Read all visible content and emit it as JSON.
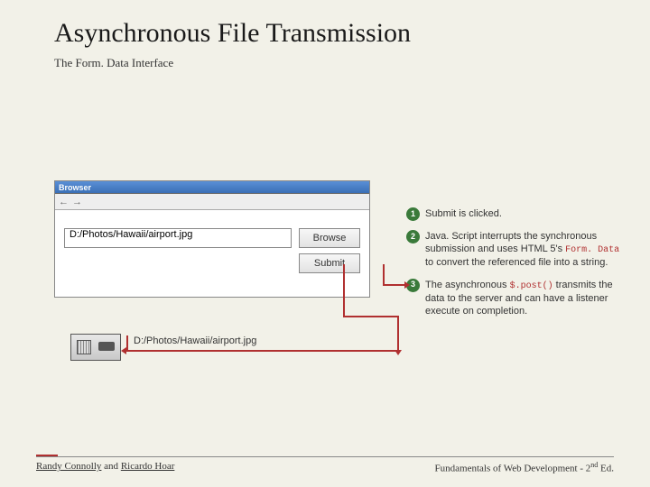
{
  "title": "Asynchronous File Transmission",
  "subtitle": "The Form. Data Interface",
  "browser": {
    "title": "Browser",
    "nav_back": "←",
    "nav_fwd": "→",
    "file_value": "D:/Photos/Hawaii/airport.jpg",
    "browse_label": "Browse",
    "submit_label": "Submit"
  },
  "annotations": [
    {
      "n": "1",
      "text": "Submit is clicked."
    },
    {
      "n": "2",
      "pre": "Java. Script interrupts the synchronous submission and uses HTML 5's ",
      "code": "Form. Data",
      "post": " to convert the referenced file into a string."
    },
    {
      "n": "3",
      "pre": "The asynchronous ",
      "code": "$.post()",
      "post": " transmits the data to the server and can have a listener execute on completion."
    }
  ],
  "server_caption": "D:/Photos/Hawaii/airport.jpg",
  "footer": {
    "author1": "Randy Connolly",
    "join": " and ",
    "author2": "Ricardo Hoar",
    "book_pre": "Fundamentals of Web Development - 2",
    "book_sup": "nd",
    "book_post": " Ed."
  }
}
